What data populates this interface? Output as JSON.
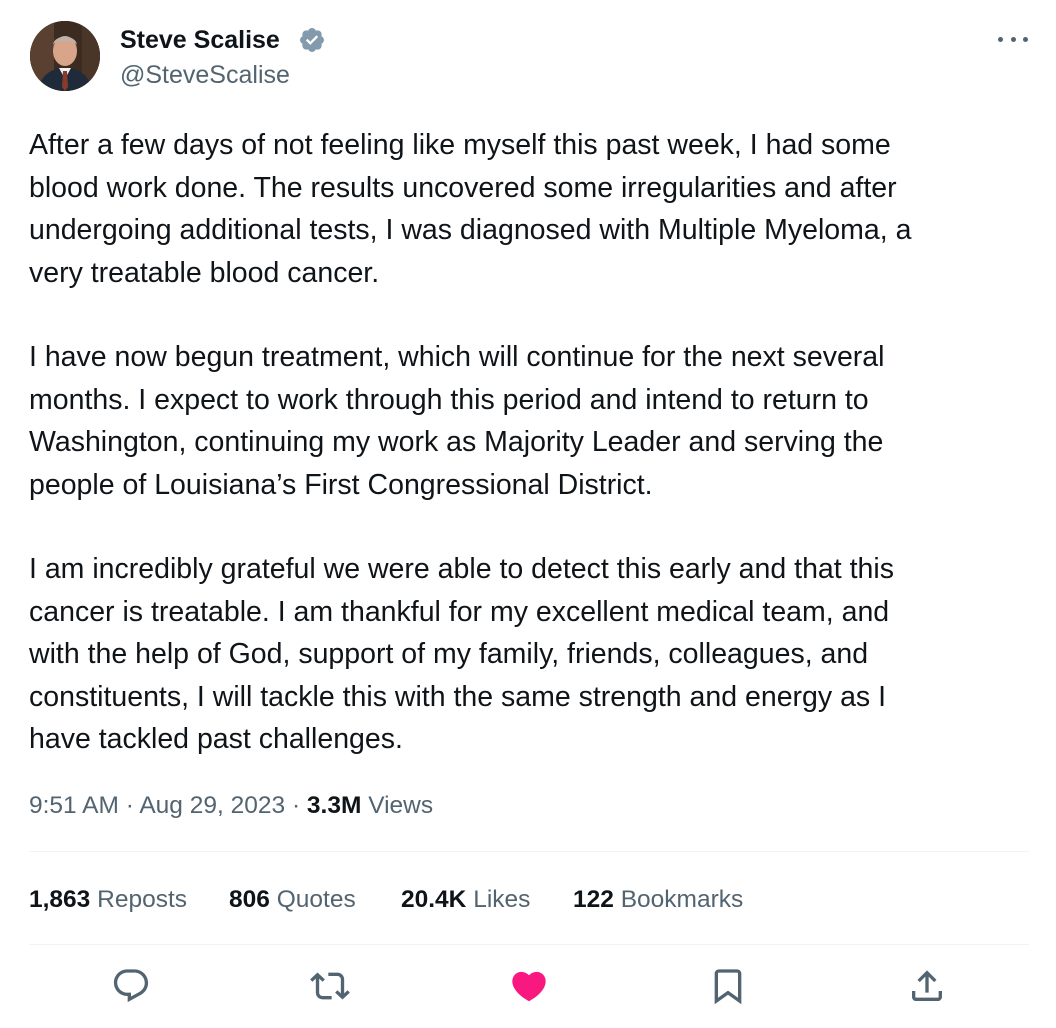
{
  "author": {
    "display_name": "Steve Scalise",
    "handle": "@SteveScalise",
    "verified_icon": "verified-badge-icon"
  },
  "more_icon": "more-dots-icon",
  "tweet": {
    "paragraphs": [
      "After a few days of not feeling like myself this past week, I had some\nblood work done. The results uncovered some irregularities and after\nundergoing additional tests, I was diagnosed with Multiple Myeloma, a\nvery treatable blood cancer.",
      "I have now begun treatment, which will continue for the next several\nmonths. I expect to work through this period and intend to return to\nWashington, continuing my work as Majority Leader and serving the\npeople of Louisiana’s First Congressional District.",
      "I am incredibly grateful we were able to detect this early and that this\ncancer is treatable. I am thankful for my excellent medical team, and\nwith the help of God, support of my family, friends, colleagues, and\nconstituents, I will tackle this with the same strength and energy as I\nhave tackled past challenges."
    ]
  },
  "meta": {
    "time": "9:51 AM",
    "sep1": "·",
    "date": "Aug 29, 2023",
    "sep2": "·",
    "views_count": "3.3M",
    "views_label": "Views"
  },
  "stats": {
    "reposts": {
      "count": "1,863",
      "label": "Reposts"
    },
    "quotes": {
      "count": "806",
      "label": "Quotes"
    },
    "likes": {
      "count": "20.4K",
      "label": "Likes"
    },
    "bookmarks": {
      "count": "122",
      "label": "Bookmarks"
    }
  },
  "actions": [
    {
      "name": "reply",
      "icon": "reply-icon"
    },
    {
      "name": "repost",
      "icon": "repost-icon"
    },
    {
      "name": "like",
      "icon": "heart-icon",
      "active": true
    },
    {
      "name": "bookmark",
      "icon": "bookmark-icon"
    },
    {
      "name": "share",
      "icon": "share-icon"
    }
  ],
  "colors": {
    "text": "#0f1419",
    "secondary": "#536471",
    "verified": "#829aab",
    "like_active": "#f91880",
    "divider": "#eff3f4"
  }
}
